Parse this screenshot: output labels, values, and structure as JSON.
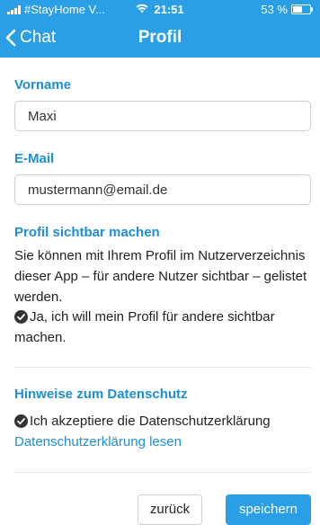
{
  "status_bar": {
    "carrier": "#StayHome V...",
    "time": "21:51",
    "battery_text": "53 %",
    "battery_level": 0.53
  },
  "nav": {
    "back_label": "Chat",
    "title": "Profil"
  },
  "form": {
    "first_name_label": "Vorname",
    "first_name_value": "Maxi",
    "email_label": "E-Mail",
    "email_value": "mustermann@email.de"
  },
  "visibility": {
    "title": "Profil sichtbar machen",
    "description": "Sie können mit Ihrem Profil im Nutzerverzeichnis dieser App – für andere Nutzer sichtbar – gelistet werden.",
    "checkbox_label": "Ja, ich will mein Profil für andere sichtbar machen.",
    "checked": true
  },
  "privacy": {
    "title": "Hinweise zum Datenschutz",
    "checkbox_label": "Ich akzeptiere die Datenschutzerklärung",
    "checked": true,
    "link": "Datenschutzerklärung lesen"
  },
  "actions": {
    "back_label": "zurück",
    "save_label": "speichern"
  },
  "colors": {
    "accent": "#2a9fe6",
    "heading": "#1c8fd8"
  }
}
